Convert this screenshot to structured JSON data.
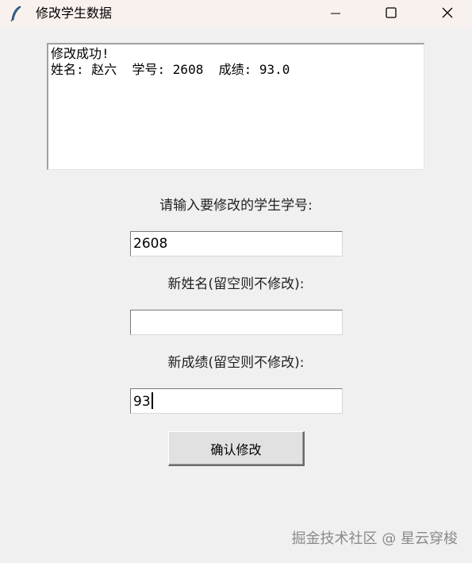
{
  "window": {
    "title": "修改学生数据",
    "icon": "feather-icon",
    "controls": [
      "minimize-icon",
      "maximize-icon",
      "close-icon"
    ]
  },
  "output": {
    "line1": "修改成功!",
    "line2": "姓名: 赵六  学号: 2608  成绩: 93.0"
  },
  "form": {
    "id_label": "请输入要修改的学生学号:",
    "id_value": "2608",
    "name_label": "新姓名(留空则不修改):",
    "name_value": "",
    "score_label": "新成绩(留空则不修改):",
    "score_value": "93",
    "confirm_label": "确认修改"
  },
  "watermark": "掘金技术社区 @ 星云穿梭"
}
